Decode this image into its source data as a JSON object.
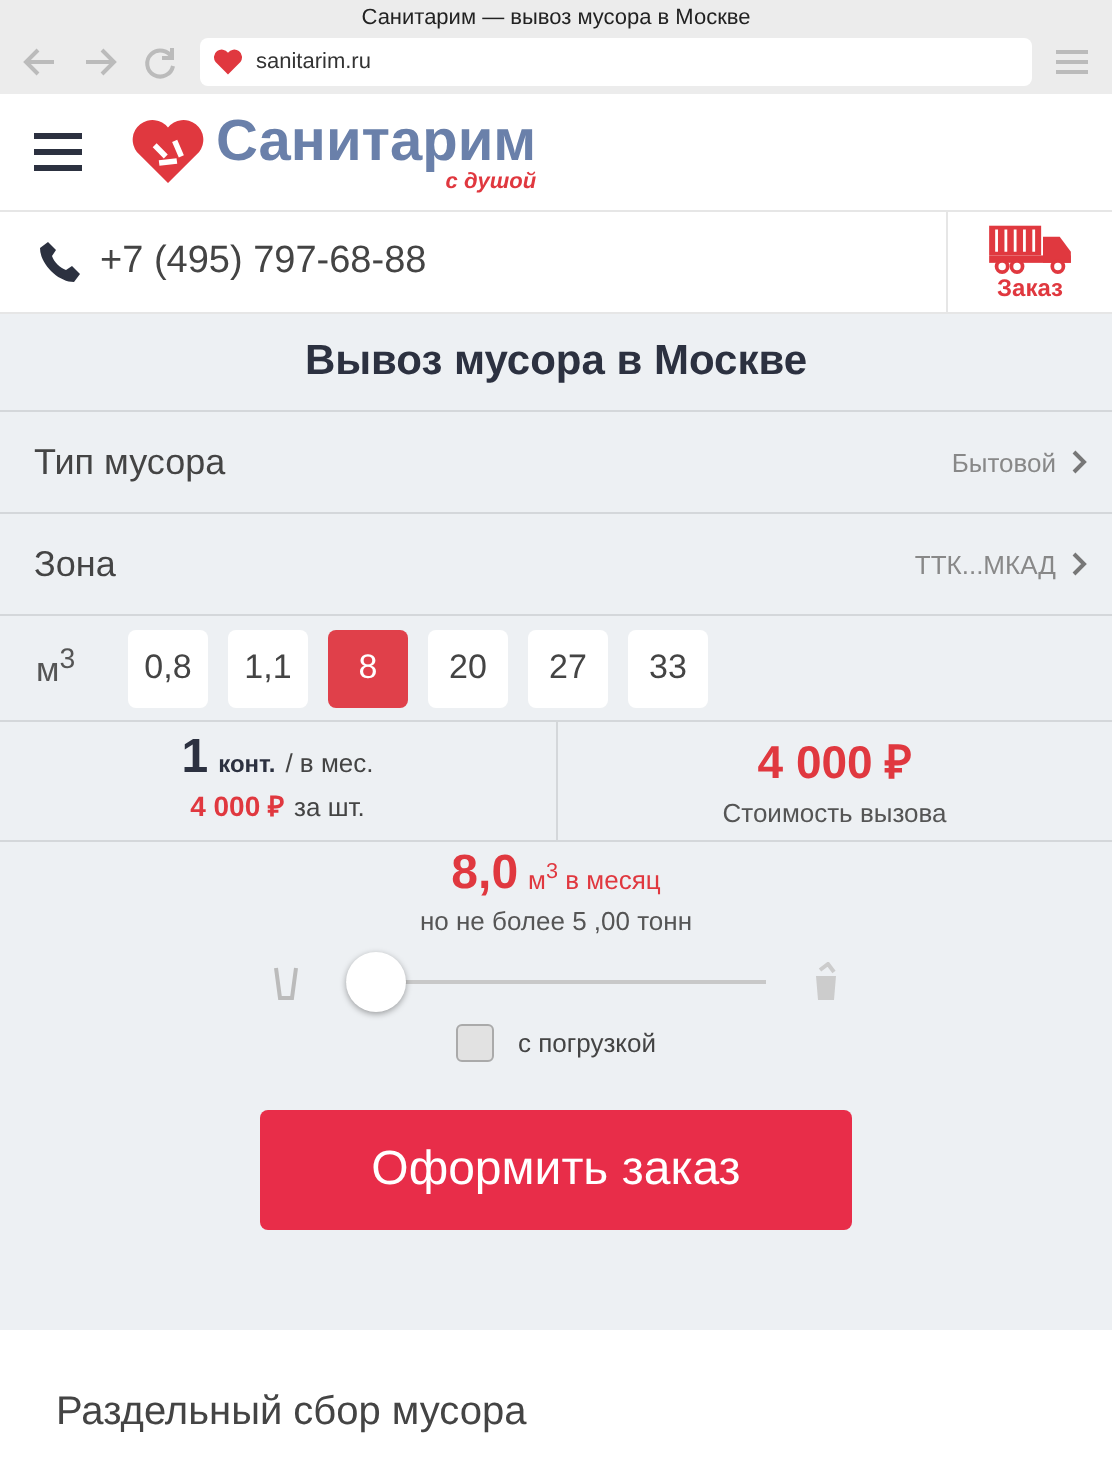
{
  "browser": {
    "title": "Санитарим — вывоз мусора в Москве",
    "url": "sanitarim.ru"
  },
  "header": {
    "logo": "Санитарим",
    "tagline": "с душой",
    "phone": "+7 (495) 797-68-88",
    "order_link": "Заказ"
  },
  "calculator": {
    "title": "Вывоз мусора в Москве",
    "options": [
      {
        "label": "Тип мусора",
        "value": "Бытовой"
      },
      {
        "label": "Зона",
        "value": "ТТК...МКАД"
      }
    ],
    "volume_label": "м$^{3}$",
    "volumes": [
      {
        "label": "0,8",
        "selected": false
      },
      {
        "label": "1,1",
        "selected": false
      },
      {
        "label": "8",
        "selected": true
      },
      {
        "label": "20",
        "selected": false
      },
      {
        "label": "27",
        "selected": false
      },
      {
        "label": "33",
        "selected": false
      }
    ],
    "count": "1",
    "count_unit": "конт.",
    "count_period": "/ в мес.",
    "unit_price": "4 000 ₽",
    "unit_price_suffix": "за шт.",
    "call_price": "4 000 ₽",
    "call_price_label": "Стоимость вызова",
    "monthly_volume": "8,0",
    "monthly_unit": "м$^{3}$ в месяц",
    "weight_limit": "но не более 5 ,00 тонн",
    "slider": {
      "level": 0
    },
    "loading": {
      "label": "с погрузкой",
      "checked": false
    },
    "submit": "Оформить заказ"
  },
  "next_section": {
    "title": "Раздельный сбор мусора"
  }
}
